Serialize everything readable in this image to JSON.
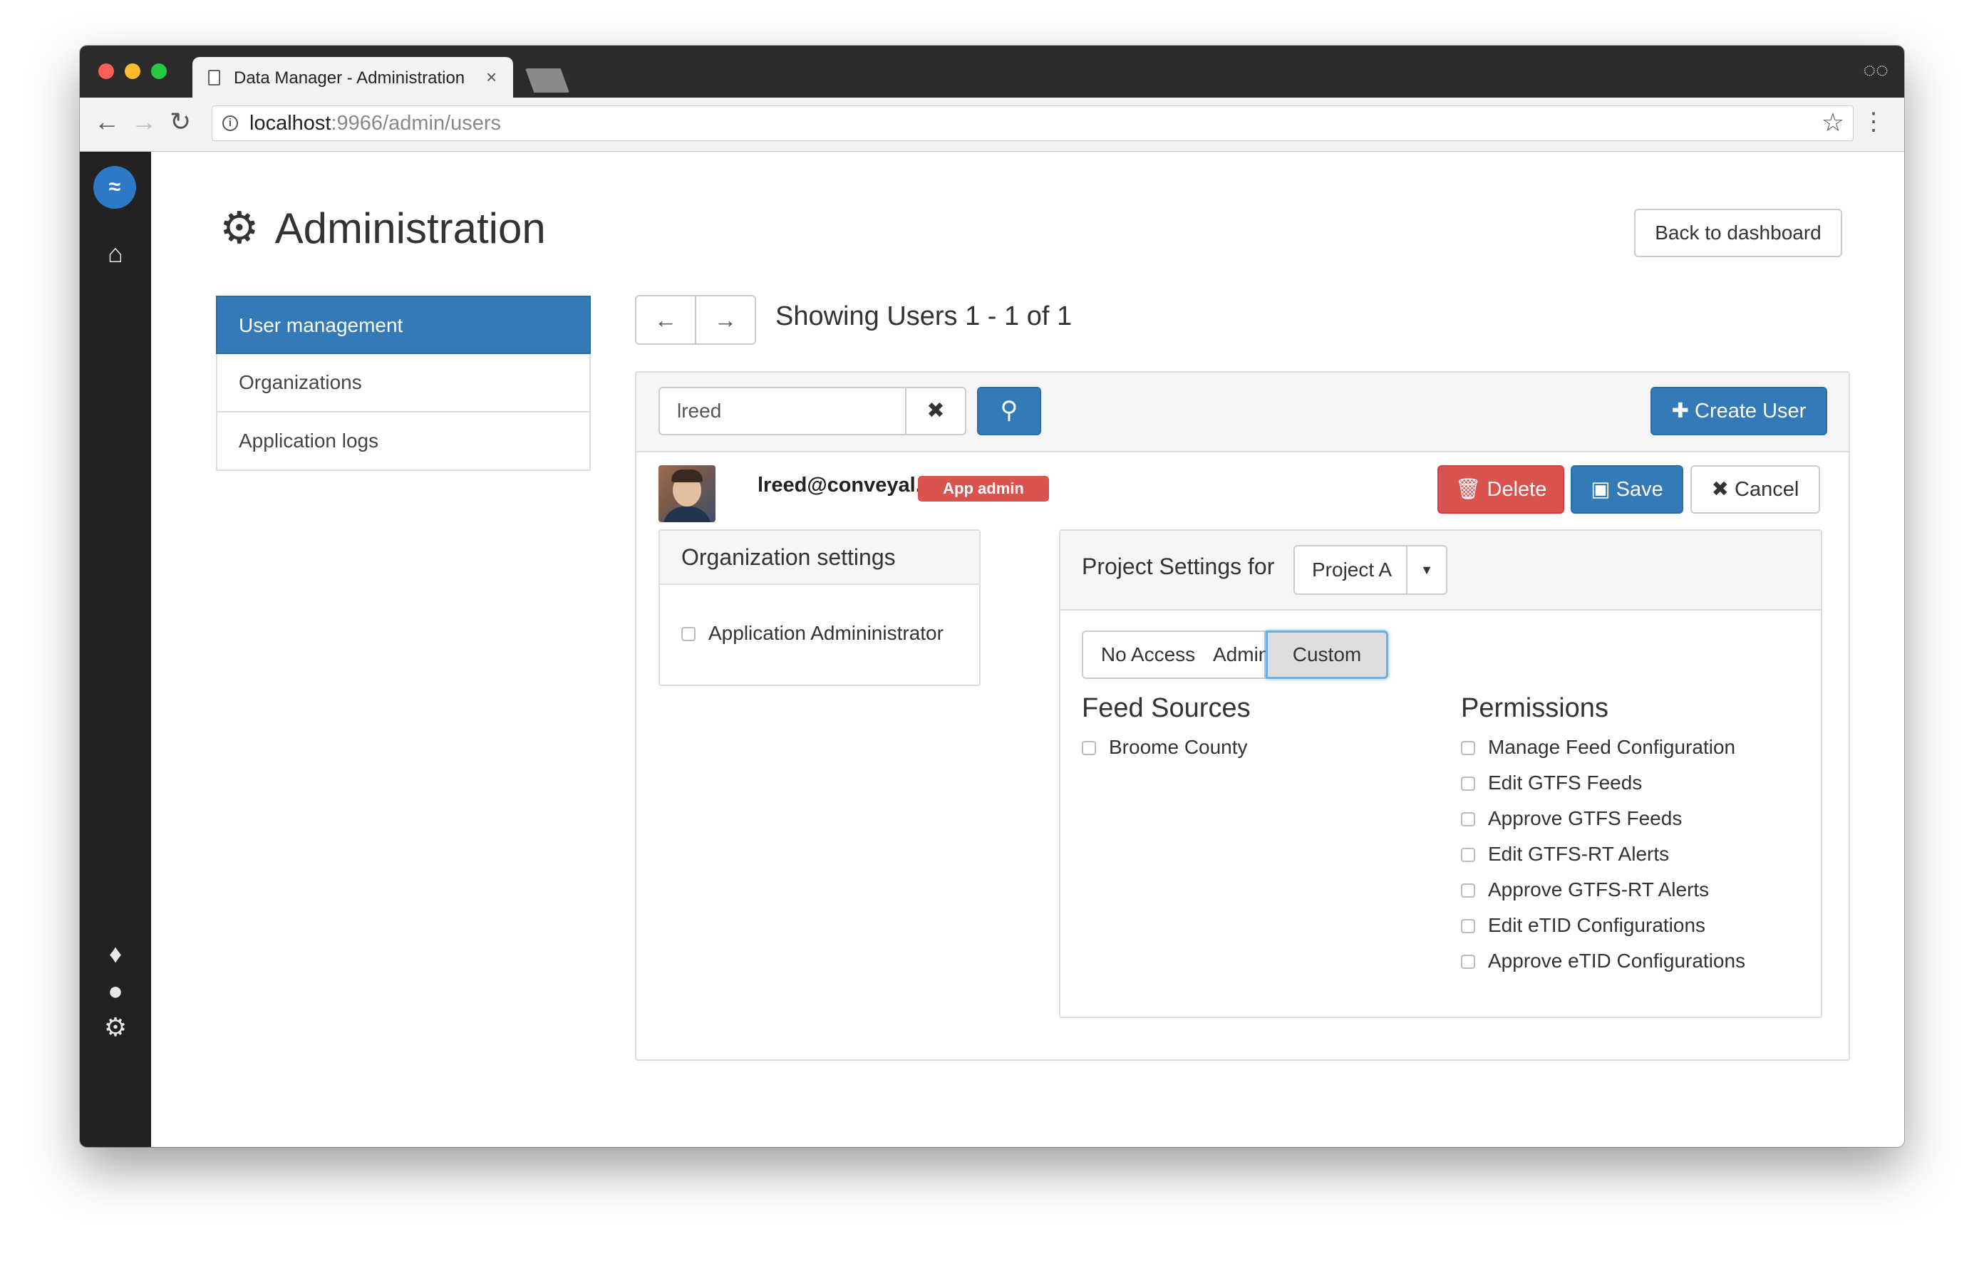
{
  "browser": {
    "tab_title": "Data Manager - Administration",
    "tab_close": "×",
    "url_host": "localhost",
    "url_path": ":9966/admin/users",
    "info_symbol": "i"
  },
  "page": {
    "title": "Administration",
    "back_button": "Back to dashboard"
  },
  "admin_menu": {
    "items": [
      {
        "label": "User management",
        "active": true
      },
      {
        "label": "Organizations",
        "active": false
      },
      {
        "label": "Application logs",
        "active": false
      }
    ]
  },
  "pager": {
    "showing_text": "Showing Users 1 - 1 of 1"
  },
  "search": {
    "value": "lreed",
    "create_button": "Create User"
  },
  "user": {
    "email": "lreed@conveyal.com",
    "badge": "App admin",
    "delete_button": "Delete",
    "save_button": "Save",
    "cancel_button": "Cancel"
  },
  "org_settings": {
    "title": "Organization settings",
    "checkbox_label": "Application Admininistrator",
    "checked": false
  },
  "project_settings": {
    "title": "Project Settings for",
    "selected_project": "Project A",
    "access_options": [
      "No Access",
      "Admin",
      "Custom"
    ],
    "selected_access": "Custom",
    "feed_sources_title": "Feed Sources",
    "feed_sources": [
      {
        "label": "Broome County",
        "checked": false
      }
    ],
    "permissions_title": "Permissions",
    "permissions": [
      {
        "label": "Manage Feed Configuration",
        "checked": false
      },
      {
        "label": "Edit GTFS Feeds",
        "checked": false
      },
      {
        "label": "Approve GTFS Feeds",
        "checked": false
      },
      {
        "label": "Edit GTFS-RT Alerts",
        "checked": false
      },
      {
        "label": "Approve GTFS-RT Alerts",
        "checked": false
      },
      {
        "label": "Edit eTID Configurations",
        "checked": false
      },
      {
        "label": "Approve eTID Configurations",
        "checked": false
      }
    ]
  },
  "colors": {
    "primary": "#337ab7",
    "danger": "#d9534f",
    "sidebar": "#222222"
  }
}
